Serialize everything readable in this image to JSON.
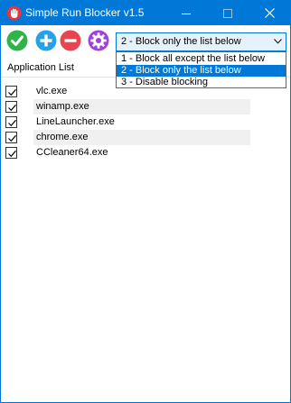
{
  "window": {
    "title": "Simple Run Blocker v1.5",
    "accent_color": "#0078d7"
  },
  "toolbar": {
    "buttons": [
      {
        "icon": "checkmark-icon",
        "color": "#2fb34a"
      },
      {
        "icon": "plus-icon",
        "color": "#26a0e6"
      },
      {
        "icon": "minus-icon",
        "color": "#e8454f"
      },
      {
        "icon": "gear-icon",
        "color": "#a23fe0"
      }
    ],
    "mode_select": {
      "value": "2 - Block only the list below",
      "options": [
        "1 - Block all except the list below",
        "2 - Block only the list below",
        "3 - Disable blocking"
      ],
      "selected_index": 1
    }
  },
  "list": {
    "header": "Application List",
    "items": [
      {
        "name": "vlc.exe",
        "checked": true
      },
      {
        "name": "winamp.exe",
        "checked": true
      },
      {
        "name": "LineLauncher.exe",
        "checked": true
      },
      {
        "name": "chrome.exe",
        "checked": true
      },
      {
        "name": "CCleaner64.exe",
        "checked": true
      }
    ]
  }
}
